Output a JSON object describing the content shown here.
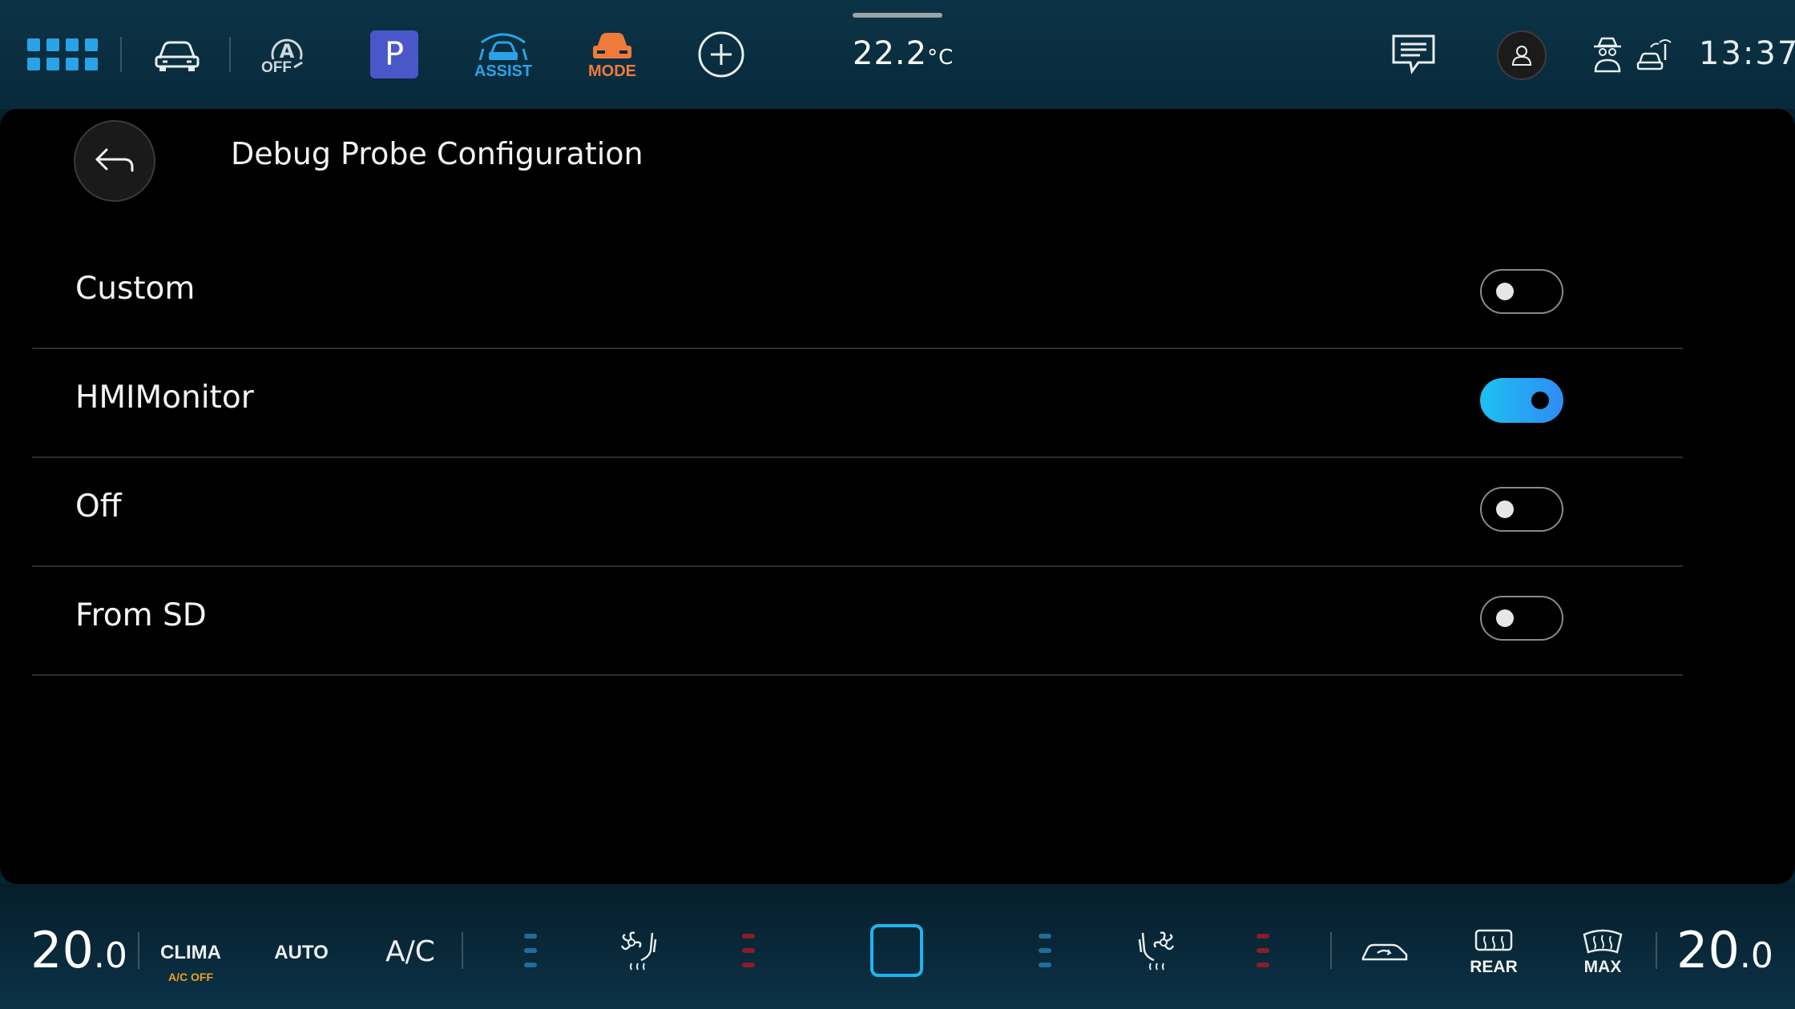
{
  "topbar": {
    "auto_hold_label": "OFF",
    "park_label": "P",
    "assist_label": "ASSIST",
    "mode_label": "MODE",
    "outside_temp": "22.2",
    "outside_temp_unit": "°C",
    "clock": "13:37",
    "colors": {
      "accent": "#2aa3e6",
      "park_bg": "#4a57c9",
      "mode": "#f07a3a"
    }
  },
  "page": {
    "title": "Debug Probe Configuration"
  },
  "options": [
    {
      "label": "Custom",
      "enabled": false
    },
    {
      "label": "HMIMonitor",
      "enabled": true
    },
    {
      "label": "Off",
      "enabled": false
    },
    {
      "label": "From SD",
      "enabled": false
    }
  ],
  "climate": {
    "left_temp": "20",
    "left_temp_decimal": ".0",
    "clima_label": "CLIMA",
    "ac_status": "A/C OFF",
    "auto_label": "AUTO",
    "ac_label": "A/C",
    "rear_label": "REAR",
    "max_label": "MAX",
    "right_temp": "20",
    "right_temp_decimal": ".0",
    "colors": {
      "ac_status": "#f0a020",
      "cool": "#1f6d9a",
      "heat": "#8c1c2a",
      "center": "#1eb4f0"
    }
  }
}
